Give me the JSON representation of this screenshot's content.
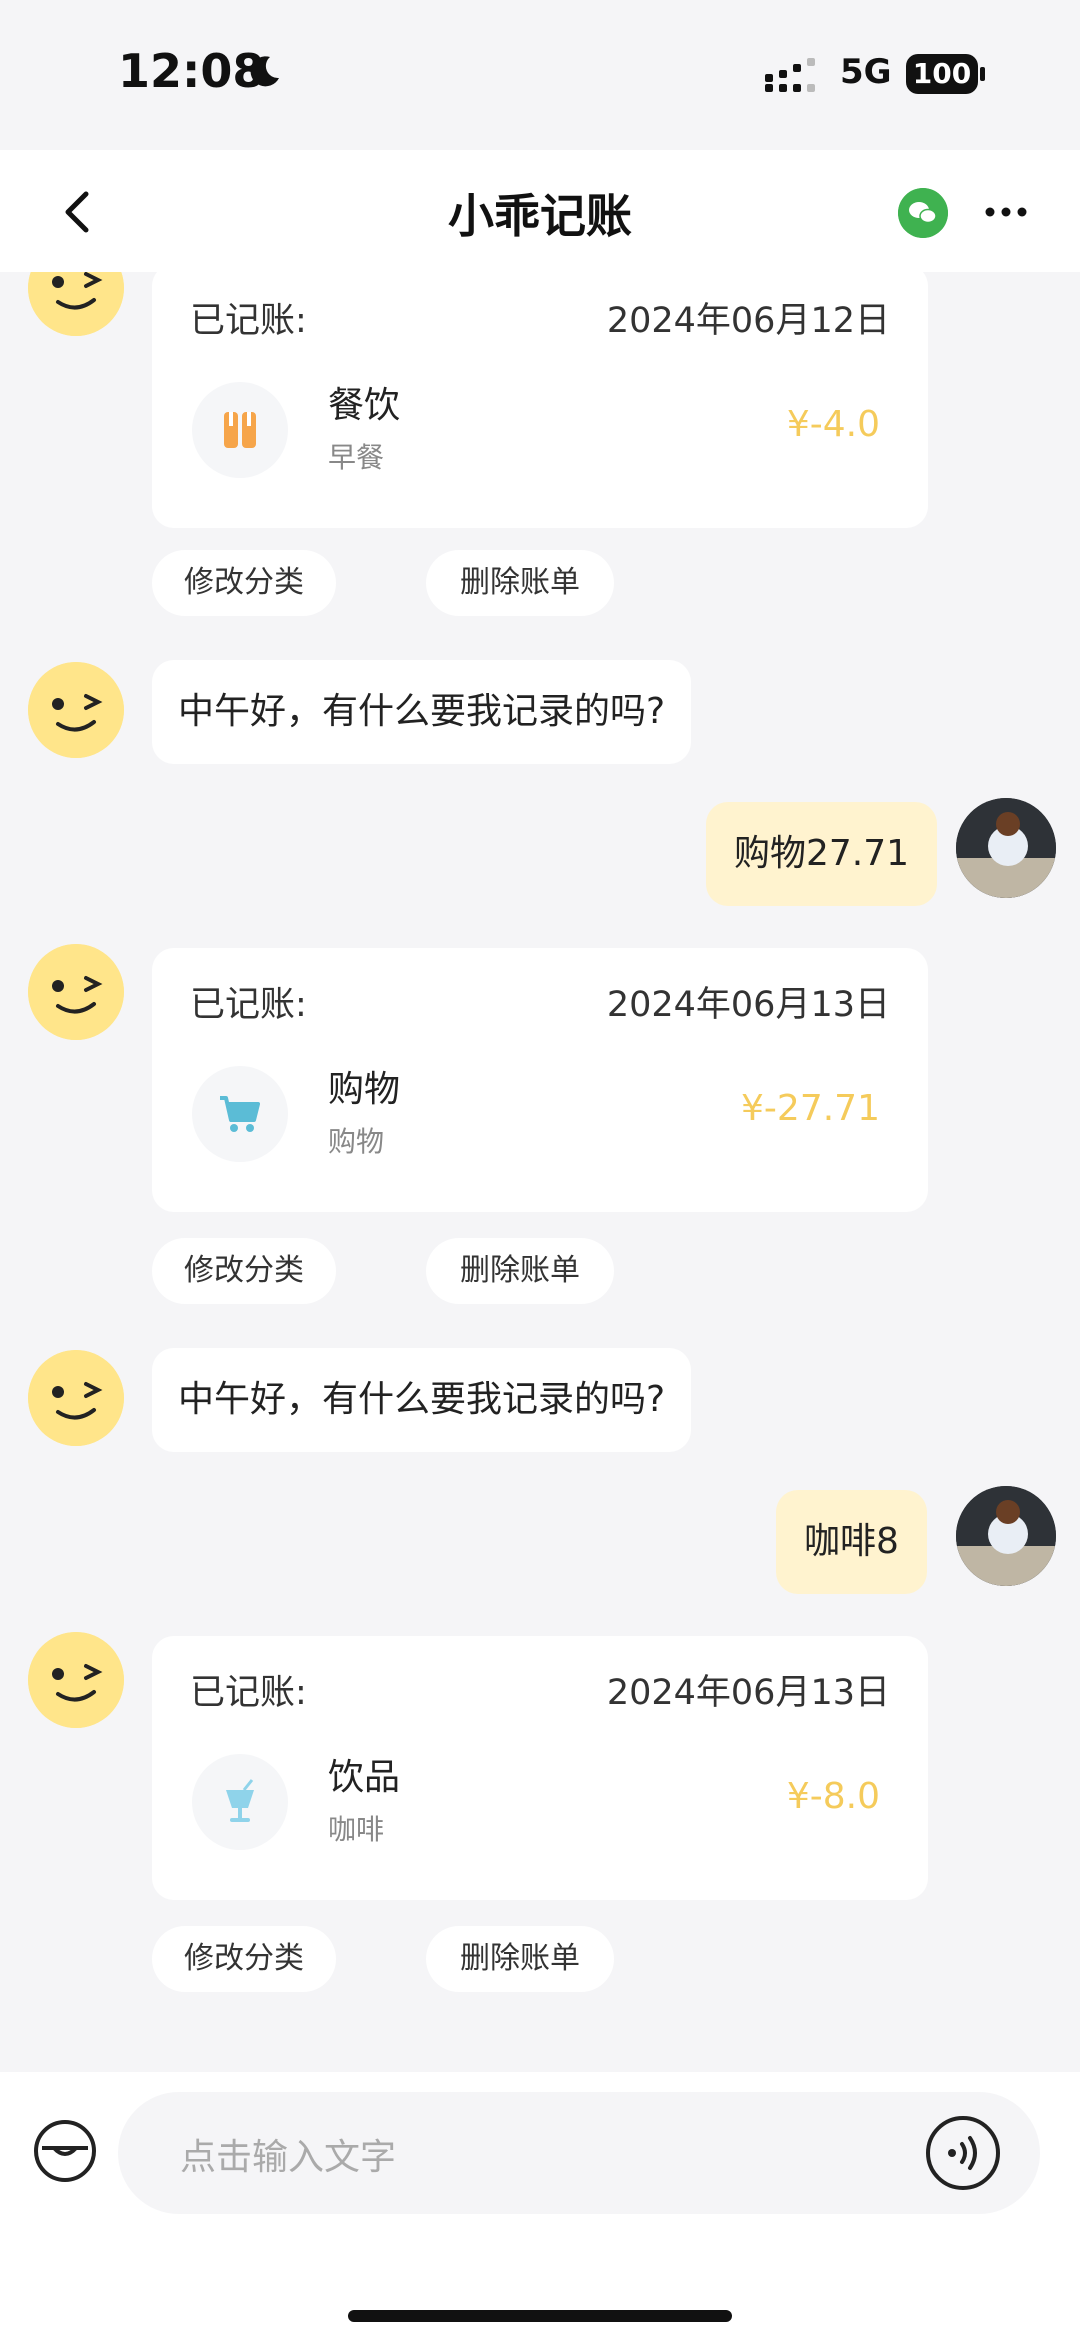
{
  "status": {
    "time": "12:08",
    "network": "5G",
    "battery": "100"
  },
  "header": {
    "title": "小乖记账"
  },
  "cards": [
    {
      "label": "已记账:",
      "date": "2024年06月12日",
      "category": "餐饮",
      "sub": "早餐",
      "amount": "¥-4.0",
      "icon": "utensils-icon"
    },
    {
      "label": "已记账:",
      "date": "2024年06月13日",
      "category": "购物",
      "sub": "购物",
      "amount": "¥-27.71",
      "icon": "cart-icon"
    },
    {
      "label": "已记账:",
      "date": "2024年06月13日",
      "category": "饮品",
      "sub": "咖啡",
      "amount": "¥-8.0",
      "icon": "drink-icon"
    }
  ],
  "actions": {
    "edit": "修改分类",
    "delete": "删除账单"
  },
  "messages": {
    "greeting1": "中午好，有什么要我记录的吗?",
    "user1": "购物27.71",
    "greeting2": "中午好，有什么要我记录的吗?",
    "user2": "咖啡8"
  },
  "input": {
    "placeholder": "点击输入文字"
  }
}
